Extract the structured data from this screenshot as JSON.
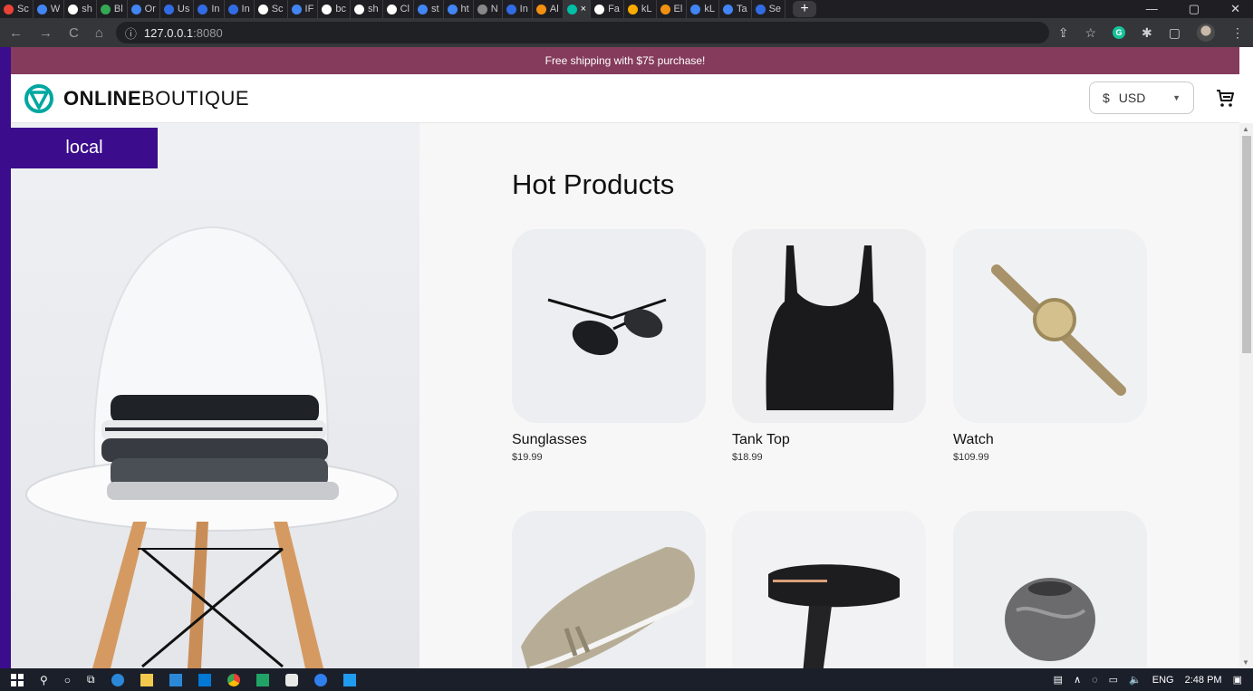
{
  "browser": {
    "tabs": [
      {
        "label": "Sc",
        "color": "#ea4335"
      },
      {
        "label": "W",
        "color": "#4285f4"
      },
      {
        "label": "sh",
        "color": "#ffffff"
      },
      {
        "label": "Bl",
        "color": "#34a853"
      },
      {
        "label": "Or",
        "color": "#4285f4"
      },
      {
        "label": "Us",
        "color": "#326ce5"
      },
      {
        "label": "In",
        "color": "#326ce5"
      },
      {
        "label": "In",
        "color": "#326ce5"
      },
      {
        "label": "Sc",
        "color": "#ffffff"
      },
      {
        "label": "IF",
        "color": "#4285f4"
      },
      {
        "label": "bc",
        "color": "#ffffff"
      },
      {
        "label": "sh",
        "color": "#ffffff"
      },
      {
        "label": "Cl",
        "color": "#ffffff"
      },
      {
        "label": "st",
        "color": "#4285f4"
      },
      {
        "label": "ht",
        "color": "#4285f4"
      },
      {
        "label": "N",
        "color": "#888888"
      },
      {
        "label": "In",
        "color": "#326ce5"
      },
      {
        "label": "Al",
        "color": "#f29111"
      },
      {
        "label": "×",
        "color": "#00bfa5",
        "active": true
      },
      {
        "label": "Fa",
        "color": "#ffffff"
      },
      {
        "label": "kL",
        "color": "#f9ab00"
      },
      {
        "label": "El",
        "color": "#f29111"
      },
      {
        "label": "kL",
        "color": "#4285f4"
      },
      {
        "label": "Ta",
        "color": "#4285f4"
      },
      {
        "label": "Se",
        "color": "#326ce5"
      }
    ],
    "new_tab": "+",
    "controls": {
      "minimize": "—",
      "maximize": "▢",
      "close": "✕"
    },
    "nav": {
      "back": "←",
      "forward": "→",
      "reload": "C",
      "home": "⌂"
    },
    "url_host": "127.0.0.1",
    "url_port": ":8080",
    "info_icon": "ⓘ",
    "toolbar": {
      "share": "⇪",
      "star": "☆",
      "grammarly": "G",
      "extensions": "✱",
      "sidepanel": "▢",
      "menu": "⋮"
    }
  },
  "site": {
    "banner": "Free shipping with $75 purchase!",
    "logo_bold": "ONLINE",
    "logo_light": "BOUTIQUE",
    "currency_symbol": "$",
    "currency_code": "USD",
    "cart_icon": "cart-icon",
    "env_label": "local",
    "section_title": "Hot Products",
    "products": [
      {
        "name": "Sunglasses",
        "price": "$19.99"
      },
      {
        "name": "Tank Top",
        "price": "$18.99"
      },
      {
        "name": "Watch",
        "price": "$109.99"
      },
      {
        "name": "Loafers",
        "price": ""
      },
      {
        "name": "Hairdryer",
        "price": ""
      },
      {
        "name": "Candle Holder",
        "price": ""
      }
    ],
    "colors": {
      "banner": "#853b5c",
      "accent": "#3b0d8c",
      "logo": "#00a7a0"
    }
  },
  "taskbar": {
    "language": "ENG",
    "time": "2:48 PM"
  }
}
